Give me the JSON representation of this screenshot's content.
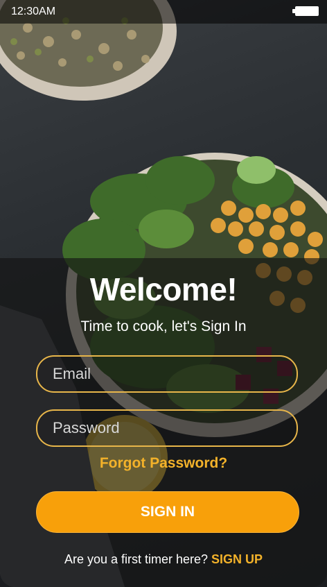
{
  "status_bar": {
    "time": "12:30AM"
  },
  "heading": {
    "title": "Welcome!",
    "subtitle": "Time to cook, let's Sign In"
  },
  "form": {
    "email_placeholder": "Email",
    "password_placeholder": "Password",
    "forgot_password": "Forgot Password?",
    "sign_in": "SIGN IN"
  },
  "footer": {
    "prompt": "Are you a first timer here?",
    "sign_up": "SIGN UP"
  },
  "colors": {
    "accent": "#f8a00a",
    "link": "#f3b22a",
    "field_border": "#e8b64a"
  },
  "icons": {
    "battery": "battery-icon"
  }
}
